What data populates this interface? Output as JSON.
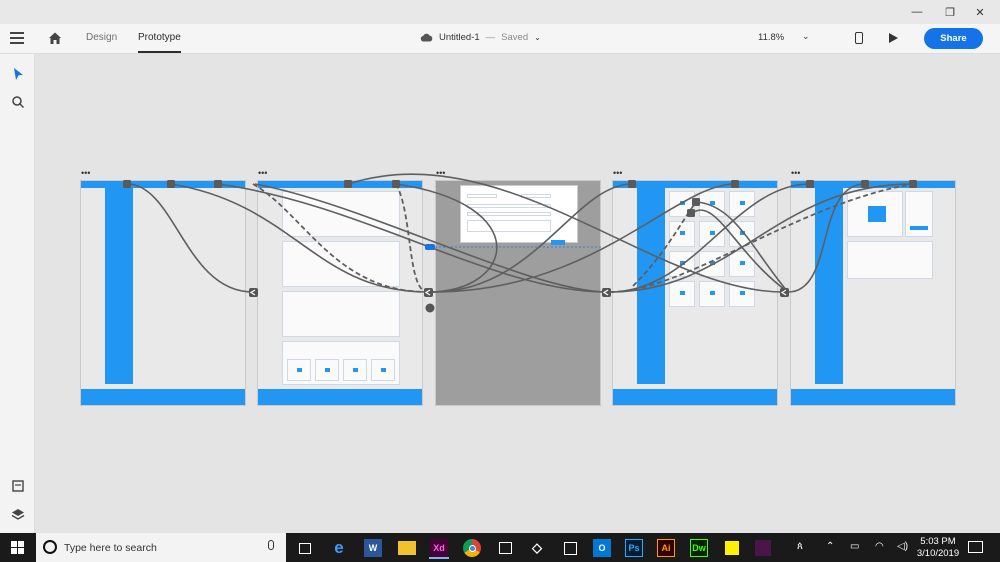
{
  "window": {
    "minimize_glyph": "—",
    "restore_glyph": "❐",
    "close_glyph": "✕"
  },
  "header": {
    "menu_icon": "hamburger-icon",
    "home_icon": "home-icon",
    "tabs": [
      {
        "label": "Design",
        "active": false
      },
      {
        "label": "Prototype",
        "active": true
      }
    ],
    "document": {
      "title": "Untitled-1",
      "separator": "—",
      "status": "Saved",
      "cloud_icon": "cloud-icon"
    },
    "zoom": "11.8%",
    "device_icon": "mobile-device-icon",
    "play_icon": "play-icon",
    "share_label": "Share",
    "accent": "#1473e6"
  },
  "left_toolbar": {
    "tools": [
      "select-arrow-icon",
      "zoom-search-icon"
    ],
    "bottom_tools": [
      "assets-icon",
      "layers-icon"
    ]
  },
  "canvas": {
    "artboard_count": 5,
    "wire_color": "#5f5f5f",
    "artboard_accent": "#2196f3",
    "artboard_menu_glyph": "•••"
  },
  "taskbar": {
    "search_placeholder": "Type here to search",
    "apps": [
      {
        "name": "task-view",
        "label": ""
      },
      {
        "name": "edge",
        "label": "e",
        "color": "#0078d7"
      },
      {
        "name": "word",
        "label": "W",
        "color": "#2b579a"
      },
      {
        "name": "file-explorer",
        "label": "",
        "color": "#f2c12e"
      },
      {
        "name": "adobe-xd",
        "label": "Xd",
        "color": "#470137"
      },
      {
        "name": "chrome",
        "label": "",
        "color": "#4285f4"
      },
      {
        "name": "store",
        "label": "",
        "color": "#ffffff"
      },
      {
        "name": "dropbox",
        "label": "",
        "color": "#0061ff"
      },
      {
        "name": "calendar",
        "label": "",
        "color": "#ffffff"
      },
      {
        "name": "outlook",
        "label": "O",
        "color": "#0078d4"
      },
      {
        "name": "photoshop",
        "label": "Ps",
        "color": "#001e36"
      },
      {
        "name": "illustrator",
        "label": "Ai",
        "color": "#330000"
      },
      {
        "name": "dreamweaver",
        "label": "Dw",
        "color": "#072401"
      },
      {
        "name": "sticky-notes",
        "label": "",
        "color": "#fff100"
      },
      {
        "name": "slack",
        "label": "",
        "color": "#4a154b"
      }
    ],
    "time": "5:03 PM",
    "date": "3/10/2019"
  }
}
